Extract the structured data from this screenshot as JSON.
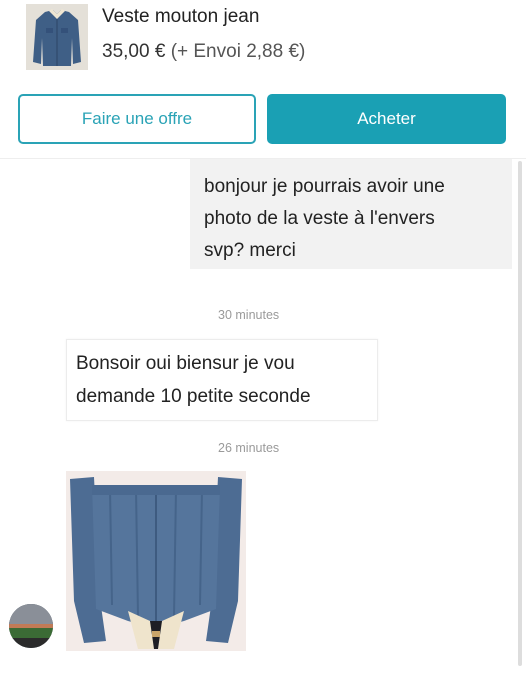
{
  "listing": {
    "title": "Veste mouton jean",
    "price": "35,00 €",
    "shipping": "(+ Envoi 2,88 €)"
  },
  "actions": {
    "offer_label": "Faire une offre",
    "buy_label": "Acheter"
  },
  "messages": [
    {
      "direction": "outgoing",
      "text": "bonjour je pourrais avoir une\nphoto de la veste à l'envers\nsvp? merci"
    },
    {
      "direction": "incoming",
      "time": "30 minutes",
      "text": "Bonsoir oui biensur je vou\ndemande 10 petite seconde"
    },
    {
      "direction": "incoming",
      "time": "26 minutes",
      "attachment": "jacket-photo"
    }
  ],
  "colors": {
    "accent": "#1aa0b4",
    "outgoing_bubble": "#f2f2f2",
    "timestamp": "#9a9a9a"
  }
}
